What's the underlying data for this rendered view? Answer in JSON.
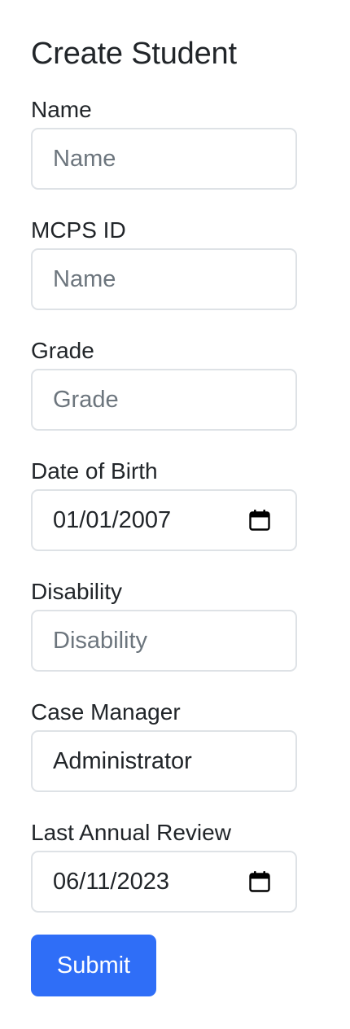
{
  "page": {
    "title": "Create Student"
  },
  "form": {
    "name": {
      "label": "Name",
      "placeholder": "Name",
      "value": ""
    },
    "mcps_id": {
      "label": "MCPS ID",
      "placeholder": "Name",
      "value": ""
    },
    "grade": {
      "label": "Grade",
      "placeholder": "Grade",
      "value": ""
    },
    "date_of_birth": {
      "label": "Date of Birth",
      "value": "01/01/2007",
      "icon": "calendar-icon"
    },
    "disability": {
      "label": "Disability",
      "placeholder": "Disability",
      "value": ""
    },
    "case_manager": {
      "label": "Case Manager",
      "value": "Administrator"
    },
    "last_annual_review": {
      "label": "Last Annual Review",
      "value": "06/11/2023",
      "icon": "calendar-icon"
    },
    "submit_label": "Submit"
  },
  "colors": {
    "primary": "#2f6ef7",
    "text": "#212529",
    "placeholder": "#6c757d",
    "border": "#dee2e6"
  }
}
